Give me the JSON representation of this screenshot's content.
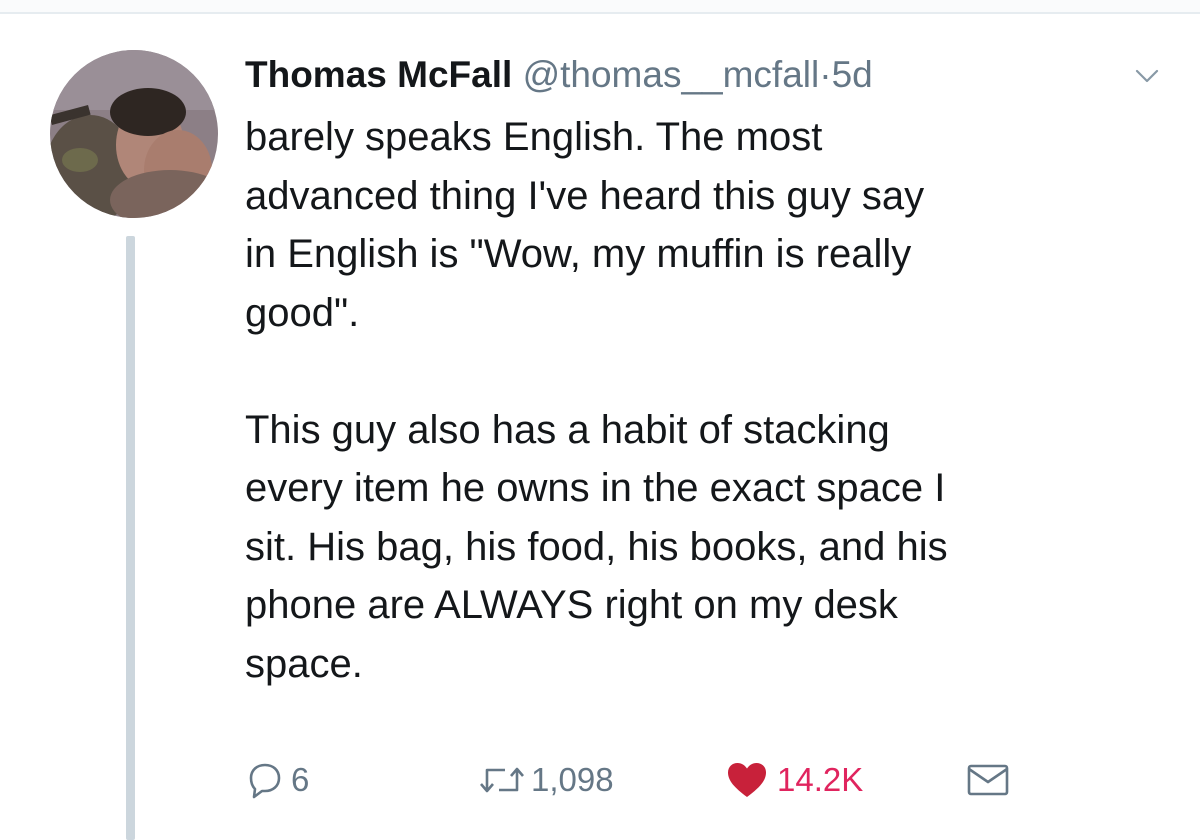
{
  "tweet": {
    "author_name": "Thomas McFall",
    "handle": "@thomas__mcfall",
    "separator": "·",
    "time": "5d",
    "paragraphs": [
      "barely speaks English. The most\nadvanced thing I've heard this guy say\nin English is \"Wow, my muffin is really\ngood\".",
      "This guy also has a habit of stacking\nevery item he owns in the exact space I\nsit. His bag, his food, his books, and his\nphone are ALWAYS right on my desk\nspace."
    ]
  },
  "actions": {
    "replies": "6",
    "retweets": "1,098",
    "likes": "14.2K"
  },
  "icons": {
    "reply": "reply-icon",
    "retweet": "retweet-icon",
    "like": "heart-icon",
    "message": "envelope-icon",
    "menu": "chevron-down-icon"
  },
  "colors": {
    "text": "#14171a",
    "muted": "#657786",
    "like": "#e0245e",
    "thread_line": "#ccd6dd"
  }
}
